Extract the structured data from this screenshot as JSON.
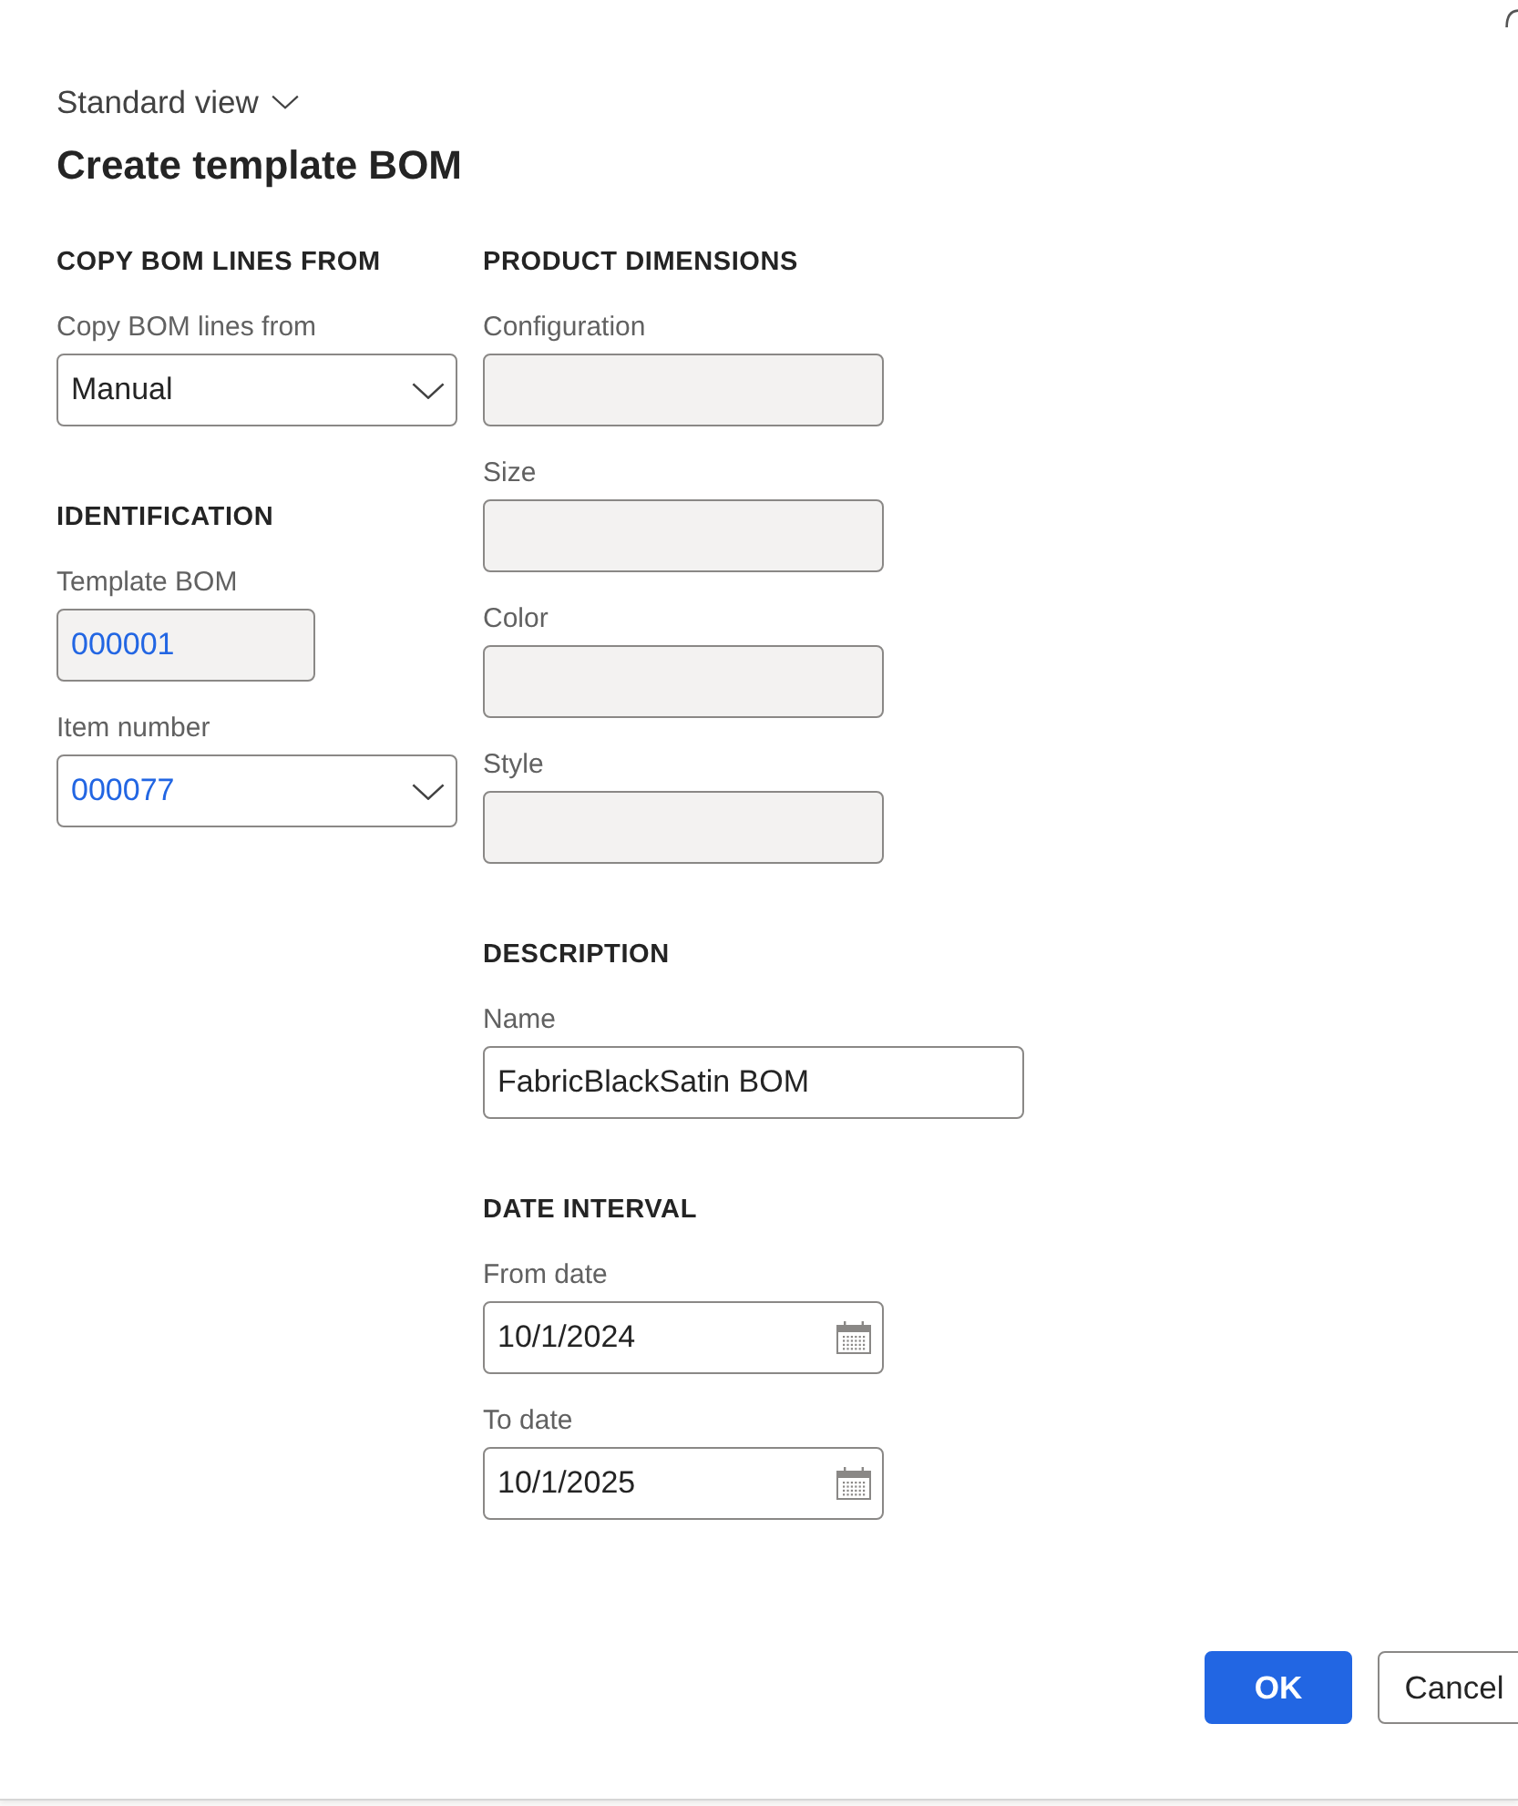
{
  "header": {
    "view_selector": "Standard view",
    "title": "Create template BOM"
  },
  "left_column": [
    {
      "heading": "COPY BOM LINES FROM",
      "fields": [
        {
          "label": "Copy BOM lines from",
          "kind": "dropdown",
          "value": "Manual",
          "disabled": false,
          "link": false
        }
      ]
    },
    {
      "heading": "IDENTIFICATION",
      "fields": [
        {
          "label": "Template BOM",
          "kind": "text",
          "value": "000001",
          "disabled": true,
          "link": true
        },
        {
          "label": "Item number",
          "kind": "dropdown",
          "value": "000077",
          "disabled": false,
          "link": true
        }
      ]
    }
  ],
  "right_column": [
    {
      "heading": "PRODUCT DIMENSIONS",
      "fields": [
        {
          "label": "Configuration",
          "kind": "text",
          "disabled": true
        },
        {
          "label": "Size",
          "kind": "text",
          "disabled": true
        },
        {
          "label": "Color",
          "kind": "text",
          "disabled": true
        },
        {
          "label": "Style",
          "kind": "text",
          "disabled": true
        }
      ]
    },
    {
      "heading": "DESCRIPTION",
      "fields": [
        {
          "label": "Name",
          "kind": "text",
          "value": "FabricBlackSatin BOM",
          "disabled": false,
          "link": false
        }
      ]
    },
    {
      "heading": "DATE INTERVAL",
      "fields": [
        {
          "label": "From date",
          "kind": "date",
          "value": "10/1/2024",
          "disabled": false,
          "link": false
        },
        {
          "label": "To date",
          "kind": "date",
          "value": "10/1/2025",
          "disabled": false,
          "link": false
        }
      ]
    }
  ],
  "buttons": [
    {
      "label": "OK",
      "primary": true
    },
    {
      "label": "Cancel",
      "primary": false
    }
  ]
}
